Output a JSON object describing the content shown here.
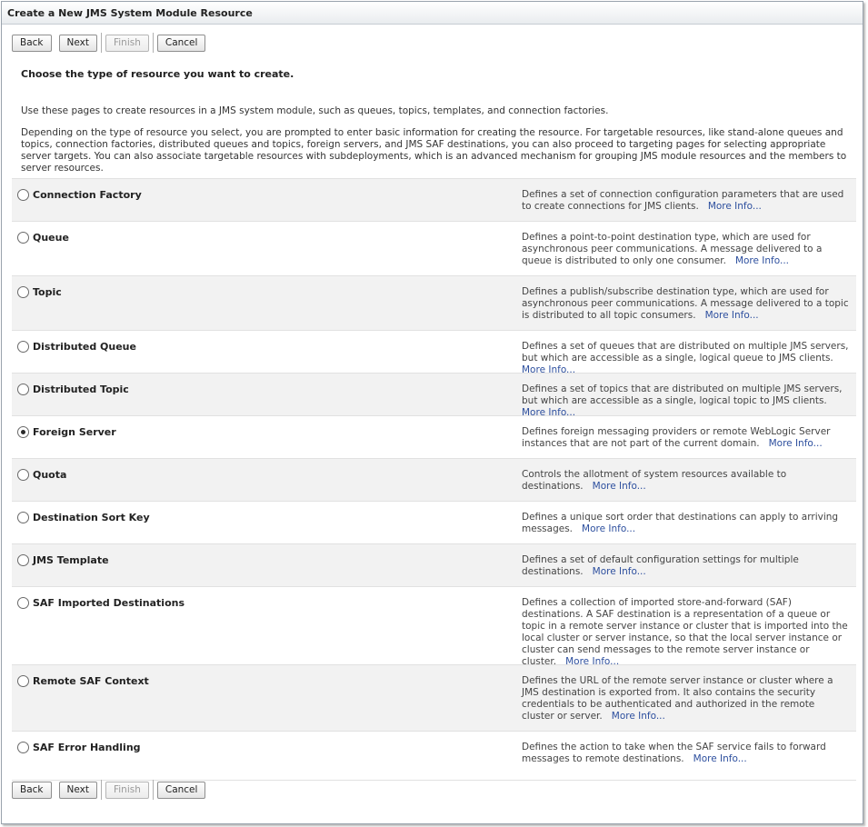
{
  "window": {
    "title": "Create a New JMS System Module Resource"
  },
  "toolbar": {
    "back": "Back",
    "next": "Next",
    "finish": "Finish",
    "cancel": "Cancel"
  },
  "page": {
    "heading": "Choose the type of resource you want to create.",
    "intro": "Use these pages to create resources in a JMS system module, such as queues, topics, templates, and connection factories.",
    "details": "Depending on the type of resource you select, you are prompted to enter basic information for creating the resource. For targetable resources, like stand-alone queues and topics, connection factories, distributed queues and topics, foreign servers, and JMS SAF destinations, you can also proceed to targeting pages for selecting appropriate server targets. You can also associate targetable resources with subdeployments, which is an advanced mechanism for grouping JMS module resources and the members to server resources."
  },
  "options": [
    {
      "label": "Connection Factory",
      "description": "Defines a set of connection configuration parameters that are used to create connections for JMS clients.",
      "more": "More Info...",
      "selected": false
    },
    {
      "label": "Queue",
      "description": "Defines a point-to-point destination type, which are used for asynchronous peer communications. A message delivered to a queue is distributed to only one consumer.",
      "more": "More Info...",
      "selected": false
    },
    {
      "label": "Topic",
      "description": "Defines a publish/subscribe destination type, which are used for asynchronous peer communications. A message delivered to a topic is distributed to all topic consumers.",
      "more": "More Info...",
      "selected": false
    },
    {
      "label": "Distributed Queue",
      "description": "Defines a set of queues that are distributed on multiple JMS servers, but which are accessible as a single, logical queue to JMS clients.",
      "more": "More Info...",
      "selected": false
    },
    {
      "label": "Distributed Topic",
      "description": "Defines a set of topics that are distributed on multiple JMS servers, but which are accessible as a single, logical topic to JMS clients.",
      "more": "More Info...",
      "selected": false
    },
    {
      "label": "Foreign Server",
      "description": "Defines foreign messaging providers or remote WebLogic Server instances that are not part of the current domain.",
      "more": "More Info...",
      "selected": true
    },
    {
      "label": "Quota",
      "description": "Controls the allotment of system resources available to destinations.",
      "more": "More Info...",
      "selected": false
    },
    {
      "label": "Destination Sort Key",
      "description": "Defines a unique sort order that destinations can apply to arriving messages.",
      "more": "More Info...",
      "selected": false
    },
    {
      "label": "JMS Template",
      "description": "Defines a set of default configuration settings for multiple destinations.",
      "more": "More Info...",
      "selected": false
    },
    {
      "label": "SAF Imported Destinations",
      "description": "Defines a collection of imported store-and-forward (SAF) destinations. A SAF destination is a representation of a queue or topic in a remote server instance or cluster that is imported into the local cluster or server instance, so that the local server instance or cluster can send messages to the remote server instance or cluster.",
      "more": "More Info...",
      "selected": false
    },
    {
      "label": "Remote SAF Context",
      "description": "Defines the URL of the remote server instance or cluster where a JMS destination is exported from. It also contains the security credentials to be authenticated and authorized in the remote cluster or server.",
      "more": "More Info...",
      "selected": false
    },
    {
      "label": "SAF Error Handling",
      "description": "Defines the action to take when the SAF service fails to forward messages to remote destinations.",
      "more": "More Info...",
      "selected": false
    }
  ]
}
